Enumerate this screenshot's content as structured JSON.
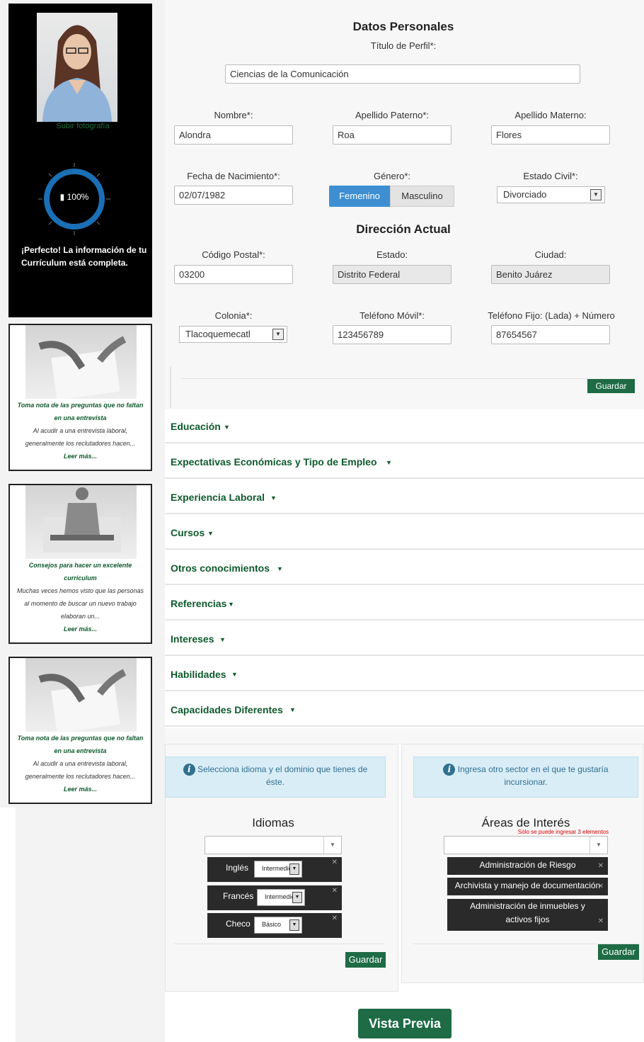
{
  "sidebar": {
    "upload_label": "Subir fotografía",
    "progress_text": "100%",
    "progress_value": 1.0,
    "complete_message": "¡Perfecto! La información de tu Currículum está completa.",
    "articles": [
      {
        "title": "Toma nota de las preguntas que no faltan en una entrevista",
        "excerpt": "Al acudir a una entrevista laboral, generalmente los reclutadores hacen...",
        "more": "Leer más..."
      },
      {
        "title": "Consejos para hacer un excelente currículum",
        "excerpt": "Muchas veces hemos visto que las personas al momento de buscar un nuevo trabajo elaboran un...",
        "more": "Leer más..."
      },
      {
        "title": "Toma nota de las preguntas que no faltan en una entrevista",
        "excerpt": "Al acudir a una entrevista laboral, generalmente los reclutadores hacen...",
        "more": "Leer más..."
      }
    ]
  },
  "personal": {
    "heading": "Datos Personales",
    "profile_title_label": "Título de Perfil*:",
    "profile_title_value": "Ciencias de la Comunicación",
    "name_label": "Nombre*:",
    "name_value": "Alondra",
    "paternal_label": "Apellido Paterno*:",
    "paternal_value": "Roa",
    "maternal_label": "Apellido Materno:",
    "maternal_value": "Flores",
    "birth_label": "Fecha de Nacimiento*:",
    "birth_value": "02/07/1982",
    "gender_label": "Género*:",
    "gender_female": "Femenino",
    "gender_male": "Masculino",
    "civil_label": "Estado Civil*:",
    "civil_value": "Divorciado"
  },
  "address": {
    "heading": "Dirección Actual",
    "zip_label": "Código Postal*:",
    "zip_value": "03200",
    "state_label": "Estado:",
    "state_value": "Distrito Federal",
    "city_label": "Ciudad:",
    "city_value": "Benito Juárez",
    "colonia_label": "Colonia*:",
    "colonia_value": "Tlacoquemecatl",
    "mobile_label": "Teléfono Móvil*:",
    "mobile_value": "123456789",
    "phone_label": "Teléfono Fijo: (Lada) + Número",
    "phone_value": "87654567",
    "save_label": "Guardar"
  },
  "sections": [
    "Educación",
    "Expectativas Económicas y Tipo de Empleo",
    "Experiencia Laboral",
    "Cursos",
    "Otros conocimientos",
    "Referencias",
    "Intereses",
    "Habilidades",
    "Capacidades Diferentes"
  ],
  "languages": {
    "info": "Selecciona idioma y el dominio que tienes de éste.",
    "heading": "Idiomas",
    "items": [
      {
        "name": "Inglés",
        "level": "Intermedio"
      },
      {
        "name": "Francés",
        "level": "Intermedio"
      },
      {
        "name": "Checo",
        "level": "Básico"
      }
    ],
    "save_label": "Guardar"
  },
  "interests": {
    "info": "Ingresa otro sector en el que te gustaría incursionar.",
    "heading": "Áreas de Interés",
    "limit_note": "Sólo se puede ingresar 3 elementos",
    "items": [
      "Administración de Riesgo",
      "Archivista y manejo de documentación",
      "Administración de inmuebles y activos fijos"
    ],
    "save_label": "Guardar"
  },
  "preview_label": "Vista Previa",
  "colors": {
    "accent": "#1e6b45",
    "brand_green": "#0e5a2c",
    "ring": "#1a6fb5",
    "gender_active": "#3d8fd1"
  }
}
